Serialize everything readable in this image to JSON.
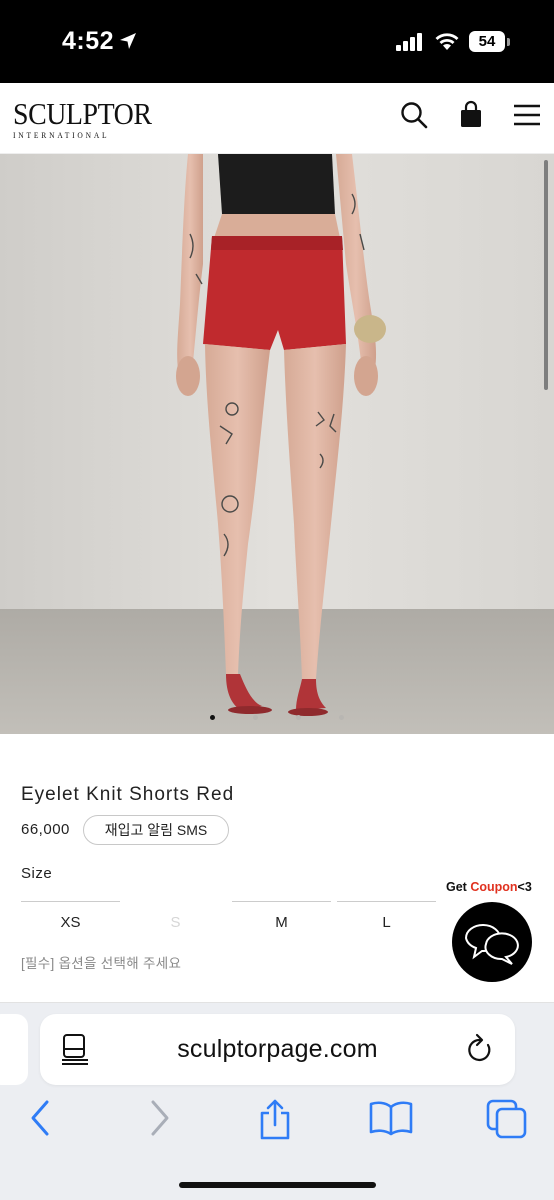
{
  "status_bar": {
    "time": "4:52",
    "battery": "54"
  },
  "header": {
    "logo_main": "SCULPTOR",
    "logo_sub": "INTERNATIONAL"
  },
  "gallery": {
    "page_count": 4,
    "active_index": 0
  },
  "product": {
    "title": "Eyelet Knit Shorts Red",
    "price": "66,000",
    "restock_label": "재입고 알림 SMS",
    "size_label": "Size",
    "sizes": [
      {
        "label": "XS",
        "available": true
      },
      {
        "label": "S",
        "available": false
      },
      {
        "label": "M",
        "available": true
      },
      {
        "label": "L",
        "available": true
      }
    ],
    "required_note": "[필수] 옵션을 선택해 주세요"
  },
  "coupon": {
    "prefix": "Get ",
    "highlight": "Coupon",
    "suffix": "<3",
    "highlight_color": "#e0311f"
  },
  "browser": {
    "url": "sculptorpage.com"
  },
  "colors": {
    "shorts": "#c02a2e",
    "top": "#1c1c1c",
    "wall": "#dedcd8",
    "floor": "#b7b4ae",
    "safari_accent": "#2f7cf6"
  }
}
